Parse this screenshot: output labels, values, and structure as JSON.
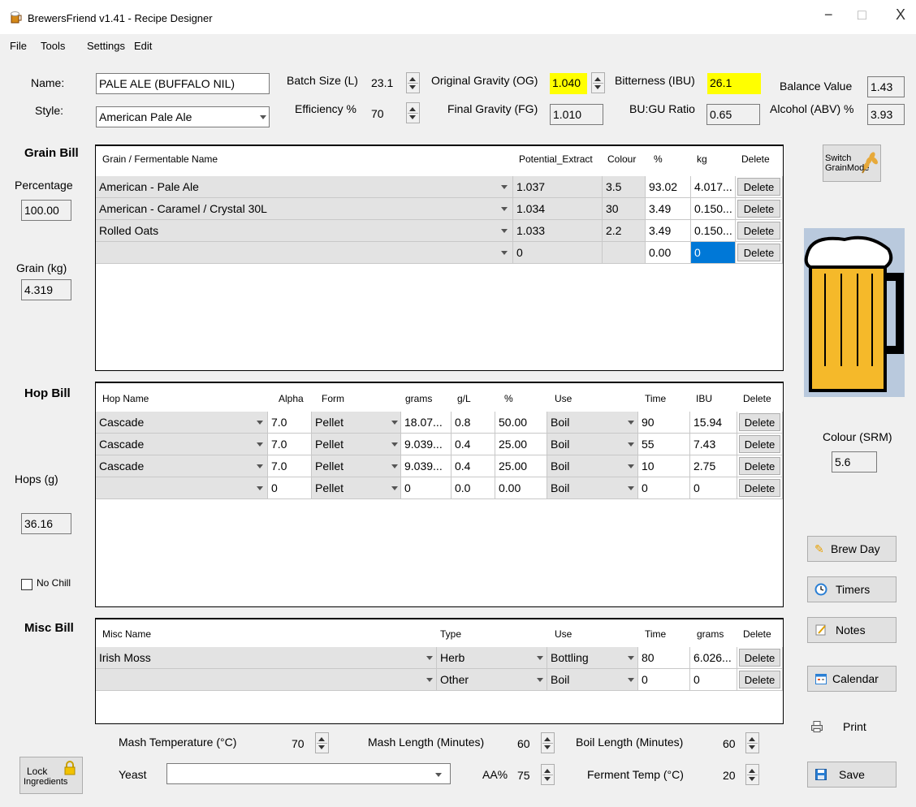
{
  "window": {
    "title": "BrewersFriend v1.41 - Recipe Designer",
    "minimize": "−",
    "maximize": "□",
    "close": "X"
  },
  "menu": [
    "File",
    "Tools",
    "Settings",
    "Edit"
  ],
  "recipe": {
    "name_label": "Name:",
    "name": "PALE ALE (BUFFALO NIL)",
    "style_label": "Style:",
    "style": "American Pale Ale",
    "batch_label": "Batch Size (L)",
    "batch": "23.1",
    "efficiency_label": "Efficiency %",
    "efficiency": "70",
    "og_label": "Original Gravity (OG)",
    "og": "1.040",
    "fg_label": "Final Gravity (FG)",
    "fg": "1.010",
    "ibu_label": "Bitterness (IBU)",
    "ibu": "26.1",
    "bugu_label": "BU:GU Ratio",
    "bugu": "0.65",
    "balance_label": "Balance Value",
    "balance": "1.43",
    "abv_label": "Alcohol (ABV) %",
    "abv": "3.93"
  },
  "grain": {
    "title": "Grain Bill",
    "percentage_label": "Percentage",
    "percentage": "100.00",
    "kg_label": "Grain (kg)",
    "kg": "4.319",
    "headers": [
      "Grain / Fermentable Name",
      "Potential_Extract",
      "Colour",
      "%",
      "kg",
      "Delete"
    ],
    "rows": [
      [
        "American - Pale Ale",
        "1.037",
        "3.5",
        "93.02",
        "4.017...",
        "Delete"
      ],
      [
        "American - Caramel / Crystal 30L",
        "1.034",
        "30",
        "3.49",
        "0.150...",
        "Delete"
      ],
      [
        "Rolled Oats",
        "1.033",
        "2.2",
        "3.49",
        "0.150...",
        "Delete"
      ],
      [
        "",
        "0",
        "",
        "0.00",
        "0",
        "Delete"
      ]
    ]
  },
  "hops": {
    "title": "Hop Bill",
    "grams_label": "Hops (g)",
    "grams": "36.16",
    "no_chill": "No Chill",
    "headers": [
      "Hop Name",
      "Alpha",
      "Form",
      "grams",
      "g/L",
      "%",
      "Use",
      "Time",
      "IBU",
      "Delete"
    ],
    "rows": [
      [
        "Cascade",
        "7.0",
        "Pellet",
        "18.07...",
        "0.8",
        "50.00",
        "Boil",
        "90",
        "15.94",
        "Delete"
      ],
      [
        "Cascade",
        "7.0",
        "Pellet",
        "9.039...",
        "0.4",
        "25.00",
        "Boil",
        "55",
        "7.43",
        "Delete"
      ],
      [
        "Cascade",
        "7.0",
        "Pellet",
        "9.039...",
        "0.4",
        "25.00",
        "Boil",
        "10",
        "2.75",
        "Delete"
      ],
      [
        "",
        "0",
        "Pellet",
        "0",
        "0.0",
        "0.00",
        "Boil",
        "0",
        "0",
        "Delete"
      ]
    ]
  },
  "misc": {
    "title": "Misc Bill",
    "headers": [
      "Misc Name",
      "Type",
      "Use",
      "Time",
      "grams",
      "Delete"
    ],
    "rows": [
      [
        "Irish Moss",
        "Herb",
        "Bottling",
        "80",
        "6.026...",
        "Delete"
      ],
      [
        "",
        "Other",
        "Boil",
        "0",
        "0",
        "Delete"
      ]
    ]
  },
  "side": {
    "switch_line1": "Switch",
    "switch_line2": "GrainMode",
    "colour_label": "Colour (SRM)",
    "colour": "5.6",
    "brew_day": "Brew Day",
    "timers": "Timers",
    "notes": "Notes",
    "calendar": "Calendar",
    "print": "Print",
    "save": "Save",
    "beer_color": "#f5b92a"
  },
  "bottom": {
    "lock_line1": "Lock",
    "lock_line2": "Ingredients",
    "mash_temp_label": "Mash Temperature (°C)",
    "mash_temp": "70",
    "mash_len_label": "Mash Length (Minutes)",
    "mash_len": "60",
    "boil_len_label": "Boil Length (Minutes)",
    "boil_len": "60",
    "yeast_label": "Yeast",
    "yeast": "",
    "aa_label": "AA%",
    "aa": "75",
    "ferment_label": "Ferment Temp (°C)",
    "ferment": "20"
  }
}
